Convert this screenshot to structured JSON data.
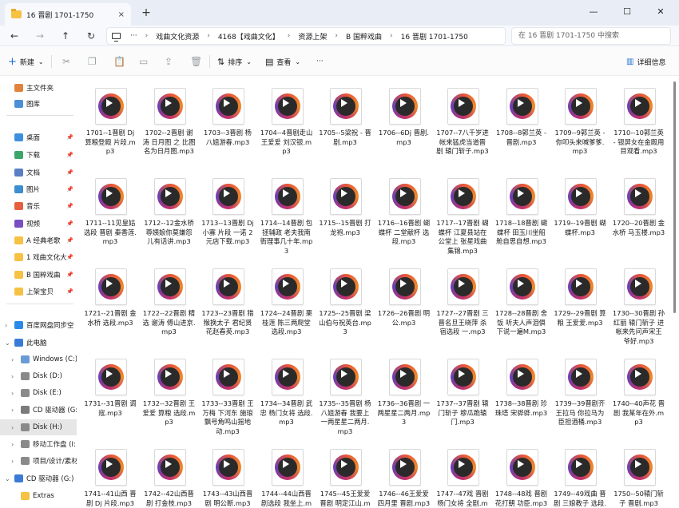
{
  "window": {
    "tab_title": "16 晋剧 1701-1750",
    "tab_close": "×",
    "new_tab": "+",
    "minimize": "—",
    "maximize": "☐",
    "close": "✕"
  },
  "nav": {
    "back": "←",
    "forward": "→",
    "up": "↑",
    "refresh": "↻",
    "more": "···",
    "breadcrumb": [
      "戏曲文化资源",
      "4168【戏曲文化】",
      "资源上架",
      "B 国粹戏曲",
      "16 晋剧 1701-1750"
    ],
    "separator": "›",
    "search_placeholder": "在 16 晋剧 1701-1750 中搜索"
  },
  "toolbar": {
    "new_label": "新建",
    "new_icon": "+",
    "sort_label": "排序",
    "view_label": "查看",
    "more": "···",
    "details_label": "详细信息",
    "dropdown": "⌄"
  },
  "sidebar": {
    "items": [
      {
        "label": "主文件夹",
        "icon": "home-icon",
        "color": "#e2833c"
      },
      {
        "label": "图库",
        "icon": "gallery-icon",
        "color": "#4a8fd8"
      },
      {
        "label": "桌面",
        "icon": "desktop-icon",
        "color": "#3f8fe0",
        "pinned": true
      },
      {
        "label": "下载",
        "icon": "download-icon",
        "color": "#3ca56a",
        "pinned": true
      },
      {
        "label": "文档",
        "icon": "documents-icon",
        "color": "#5b7fc4",
        "pinned": true
      },
      {
        "label": "图片",
        "icon": "pictures-icon",
        "color": "#3b8ed1",
        "pinned": true
      },
      {
        "label": "音乐",
        "icon": "music-icon",
        "color": "#e5603e",
        "pinned": true
      },
      {
        "label": "视频",
        "icon": "videos-icon",
        "color": "#7a4ec2",
        "pinned": true
      },
      {
        "label": "A 经典老歌",
        "icon": "folder-icon",
        "color": "#f6c244",
        "pinned": true
      },
      {
        "label": "1 戏曲文化大",
        "icon": "folder-icon",
        "color": "#f6c244",
        "pinned": true
      },
      {
        "label": "B 国粹戏曲",
        "icon": "folder-icon",
        "color": "#f6c244",
        "pinned": true
      },
      {
        "label": "上架宝贝",
        "icon": "folder-icon",
        "color": "#f6c244",
        "pinned": true
      },
      {
        "label": "百度网盘同步空",
        "icon": "cloud-icon",
        "color": "#2a8ae8",
        "chevron": "›"
      },
      {
        "label": "此电脑",
        "icon": "pc-icon",
        "color": "#3a7bd5",
        "chevron": "⌄"
      },
      {
        "label": "Windows (C:)",
        "icon": "drive-icon",
        "color": "#6a9bd6",
        "chevron": "›"
      },
      {
        "label": "Disk (D:)",
        "icon": "drive-icon",
        "color": "#8a8a8a",
        "chevron": "›"
      },
      {
        "label": "Disk (E:)",
        "icon": "drive-icon",
        "color": "#8a8a8a",
        "chevron": "›"
      },
      {
        "label": "CD 驱动器 (G:)",
        "icon": "cd-drive-icon",
        "color": "#7b7b7b",
        "chevron": "›"
      },
      {
        "label": "Disk (H:)",
        "icon": "drive-icon",
        "color": "#8a8a8a",
        "chevron": "›",
        "selected": true
      },
      {
        "label": "移动工作盘 (I:",
        "icon": "drive-icon",
        "color": "#8a8a8a",
        "chevron": "›"
      },
      {
        "label": "项目/设计/素材",
        "icon": "drive-icon",
        "color": "#8a8a8a",
        "chevron": "›"
      },
      {
        "label": "CD 驱动器 (G:)",
        "icon": "cd-drive-icon",
        "color": "#3a7bd5",
        "chevron": "⌄"
      },
      {
        "label": "Extras",
        "icon": "folder-icon",
        "color": "#f6c244"
      }
    ]
  },
  "files": [
    "1701--1晋剧 Dj 算粮登殿 片段.mp3",
    "1702--2晋剧 谢涛 日月图 之 比图名为日月图.mp3",
    "1703--3晋剧 杨八姐游春.mp3",
    "1704--4晋剧走山 王爱爱 刘汉银.mp3",
    "1705--5梁祝 - 晋剧.mp3",
    "1706--6Dj 晋剧.mp3",
    "1707--7八千岁进帐来猛虎当道晋剧 辕门斩子.mp3",
    "1708--8郭兰英 - 晋剧.mp3",
    "1709--9郭兰英 - 你叩头来喊爹爹.mp3",
    "1710--10郭兰英 - 银屏女在金殿用目观看.mp3",
    "1711--11见皇姑选段 晋剧 秦香莲.mp3",
    "1712--12金水桥 尊姨娘你莫嫌怨 儿有话讲.mp3",
    "1713--13晋剧 Dj 小寡 片段 一诺 2元店下载.mp3",
    "1714--14晋剧 包拯辅政 老夫我南衙理事几十年.mp3",
    "1715--15晋剧 打龙袍.mp3",
    "1716--16晋剧 蝴蝶杯 二堂献杯 选段.mp3",
    "1717--17晋剧 蝴蝶杯 江夏县站在公堂上 张星戏曲集锦.mp3",
    "1718--18晋剧 蝴蝶杯 田玉川坐船舱自思自想.mp3",
    "1719--19晋剧 蝴蝶杯.mp3",
    "1720--20晋剧 金水桥 马玉楼.mp3",
    "1721--21晋剧 金水桥 选段.mp3",
    "1722--22晋剧 精选 谢涛 傅山进京.mp3",
    "1723--23晋剧 猎猴换太子 君纪贤 花赵春英.mp3",
    "1724--24晋剧 栗桂莲 陈三两爬堂选段.mp3",
    "1725--25晋剧 梁山伯与祝英台.mp3",
    "1726--26晋剧 明公.mp3",
    "1727--27晋剧 三晋名旦王晓萍 杀宿选段 一.mp3",
    "1728--28晋剧 舍饭 听夫人声泪俱下说一遍M.mp3",
    "1729--29晋剧 算粮 王爱爱.mp3",
    "1730--30晋剧 孙红丽 辕门斩子 进帐来先问声宋王爷好.mp3",
    "1731--31晋剧 调寇.mp3",
    "1732--32晋剧 王爱爱 算粮 选段.mp3",
    "1733--33晋剧 王万梅 下河东 施琅飘号角鸣山摇地动.mp3",
    "1734--34晋剧 武忠 杨门女将 选段.mp3",
    "1735--35晋剧 杨八姐游春 我要上一两星星二两月.mp3",
    "1736--36晋剧 一两星星二两月.mp3",
    "1737--37晋剧 辕门斩子 穆瓜跪辕门.mp3",
    "1738--38晋剧 珍珠塔 宋骅骅.mp3",
    "1739--39晋剧齐王拉马 你拉马为臣担酒桶.mp3",
    "1740--40声花 晋剧 我某年在外.mp3",
    "1741--41山西 晋剧 Dj 片段.mp3",
    "1742--42山西晋剧 打金枝.mp3",
    "1743--43山西晋剧 明公断.mp3",
    "1744--44山西晋剧选段 我坐上.mp3",
    "1745--45王爱爱 晋剧 明定江山.mp3",
    "1746--46王爱爱 四月里 晋剧.mp3",
    "1747--47戏 晋剧 杨门女将 全剧.mp3",
    "1748--48戏 晋剧 花打朝 功臣.mp3",
    "1749--49戏曲 晋剧 三娘教子 选段.mp3",
    "1750--50辕门斩子 晋剧.mp3"
  ]
}
